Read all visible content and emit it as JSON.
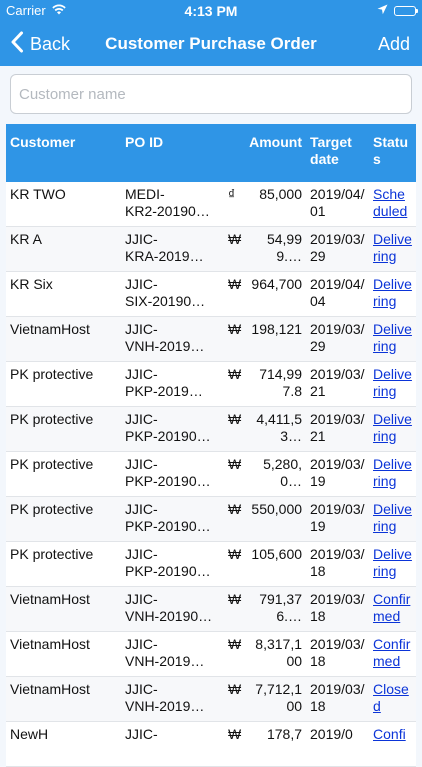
{
  "status_bar": {
    "carrier": "Carrier",
    "time": "4:13 PM"
  },
  "nav": {
    "back_label": "Back",
    "title": "Customer Purchase Order",
    "add_label": "Add"
  },
  "search": {
    "placeholder": "Customer name",
    "value": ""
  },
  "table": {
    "headers": {
      "customer": "Customer",
      "po_id": "PO ID",
      "amount": "Amount",
      "target_date": "Target date",
      "status": "Status"
    },
    "rows": [
      {
        "customer": "KR TWO",
        "po_l1": "MEDI-",
        "po_l2": "KR2-20190…",
        "currency": "₫",
        "amount": "85,000",
        "date": "2019/04/01",
        "status": "Scheduled"
      },
      {
        "customer": "KR A",
        "po_l1": "JJIC-",
        "po_l2": "KRA-2019…",
        "currency": "₩",
        "amount": "54,999.…",
        "date": "2019/03/29",
        "status": "Delivering"
      },
      {
        "customer": "KR Six",
        "po_l1": "JJIC-",
        "po_l2": "SIX-20190…",
        "currency": "₩",
        "amount": "964,700",
        "date": "2019/04/04",
        "status": "Delivering"
      },
      {
        "customer": "VietnamHost",
        "po_l1": "JJIC-",
        "po_l2": "VNH-2019…",
        "currency": "₩",
        "amount": "198,121",
        "date": "2019/03/29",
        "status": "Delivering"
      },
      {
        "customer": "PK protective",
        "po_l1": "JJIC-",
        "po_l2": "PKP-2019…",
        "currency": "₩",
        "amount": "714,997.8",
        "date": "2019/03/21",
        "status": "Delivering"
      },
      {
        "customer": "PK protective",
        "po_l1": "JJIC-",
        "po_l2": "PKP-20190…",
        "currency": "₩",
        "amount": "4,411,53…",
        "date": "2019/03/21",
        "status": "Delivering"
      },
      {
        "customer": "PK protective",
        "po_l1": "JJIC-",
        "po_l2": "PKP-20190…",
        "currency": "₩",
        "amount": "5,280,0…",
        "date": "2019/03/19",
        "status": "Delivering"
      },
      {
        "customer": "PK protective",
        "po_l1": "JJIC-",
        "po_l2": "PKP-20190…",
        "currency": "₩",
        "amount": "550,000",
        "date": "2019/03/19",
        "status": "Delivering"
      },
      {
        "customer": "PK protective",
        "po_l1": "JJIC-",
        "po_l2": "PKP-20190…",
        "currency": "₩",
        "amount": "105,600",
        "date": "2019/03/18",
        "status": "Delivering"
      },
      {
        "customer": "VietnamHost",
        "po_l1": "JJIC-",
        "po_l2": "VNH-20190…",
        "currency": "₩",
        "amount": "791,376.…",
        "date": "2019/03/18",
        "status": "Confirmed"
      },
      {
        "customer": "VietnamHost",
        "po_l1": "JJIC-",
        "po_l2": "VNH-2019…",
        "currency": "₩",
        "amount": "8,317,100",
        "date": "2019/03/18",
        "status": "Confirmed"
      },
      {
        "customer": "VietnamHost",
        "po_l1": "JJIC-",
        "po_l2": "VNH-2019…",
        "currency": "₩",
        "amount": "7,712,100",
        "date": "2019/03/18",
        "status": "Closed"
      },
      {
        "customer": "NewH",
        "po_l1": "JJIC-",
        "po_l2": "",
        "currency": "₩",
        "amount": "178,7",
        "date": "2019/0",
        "status": "Confi"
      }
    ]
  },
  "colors": {
    "accent": "#2f95e6",
    "link": "#0b34d8",
    "battery": "#2bd04b"
  }
}
